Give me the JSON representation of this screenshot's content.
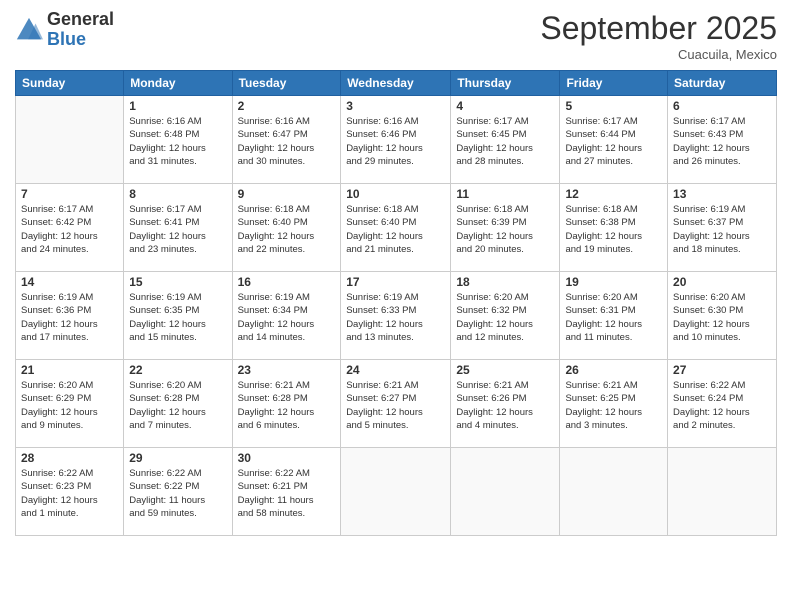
{
  "logo": {
    "general": "General",
    "blue": "Blue"
  },
  "header": {
    "month": "September 2025",
    "location": "Cuacuila, Mexico"
  },
  "weekdays": [
    "Sunday",
    "Monday",
    "Tuesday",
    "Wednesday",
    "Thursday",
    "Friday",
    "Saturday"
  ],
  "weeks": [
    [
      {
        "day": "",
        "info": ""
      },
      {
        "day": "1",
        "info": "Sunrise: 6:16 AM\nSunset: 6:48 PM\nDaylight: 12 hours\nand 31 minutes."
      },
      {
        "day": "2",
        "info": "Sunrise: 6:16 AM\nSunset: 6:47 PM\nDaylight: 12 hours\nand 30 minutes."
      },
      {
        "day": "3",
        "info": "Sunrise: 6:16 AM\nSunset: 6:46 PM\nDaylight: 12 hours\nand 29 minutes."
      },
      {
        "day": "4",
        "info": "Sunrise: 6:17 AM\nSunset: 6:45 PM\nDaylight: 12 hours\nand 28 minutes."
      },
      {
        "day": "5",
        "info": "Sunrise: 6:17 AM\nSunset: 6:44 PM\nDaylight: 12 hours\nand 27 minutes."
      },
      {
        "day": "6",
        "info": "Sunrise: 6:17 AM\nSunset: 6:43 PM\nDaylight: 12 hours\nand 26 minutes."
      }
    ],
    [
      {
        "day": "7",
        "info": "Sunrise: 6:17 AM\nSunset: 6:42 PM\nDaylight: 12 hours\nand 24 minutes."
      },
      {
        "day": "8",
        "info": "Sunrise: 6:17 AM\nSunset: 6:41 PM\nDaylight: 12 hours\nand 23 minutes."
      },
      {
        "day": "9",
        "info": "Sunrise: 6:18 AM\nSunset: 6:40 PM\nDaylight: 12 hours\nand 22 minutes."
      },
      {
        "day": "10",
        "info": "Sunrise: 6:18 AM\nSunset: 6:40 PM\nDaylight: 12 hours\nand 21 minutes."
      },
      {
        "day": "11",
        "info": "Sunrise: 6:18 AM\nSunset: 6:39 PM\nDaylight: 12 hours\nand 20 minutes."
      },
      {
        "day": "12",
        "info": "Sunrise: 6:18 AM\nSunset: 6:38 PM\nDaylight: 12 hours\nand 19 minutes."
      },
      {
        "day": "13",
        "info": "Sunrise: 6:19 AM\nSunset: 6:37 PM\nDaylight: 12 hours\nand 18 minutes."
      }
    ],
    [
      {
        "day": "14",
        "info": "Sunrise: 6:19 AM\nSunset: 6:36 PM\nDaylight: 12 hours\nand 17 minutes."
      },
      {
        "day": "15",
        "info": "Sunrise: 6:19 AM\nSunset: 6:35 PM\nDaylight: 12 hours\nand 15 minutes."
      },
      {
        "day": "16",
        "info": "Sunrise: 6:19 AM\nSunset: 6:34 PM\nDaylight: 12 hours\nand 14 minutes."
      },
      {
        "day": "17",
        "info": "Sunrise: 6:19 AM\nSunset: 6:33 PM\nDaylight: 12 hours\nand 13 minutes."
      },
      {
        "day": "18",
        "info": "Sunrise: 6:20 AM\nSunset: 6:32 PM\nDaylight: 12 hours\nand 12 minutes."
      },
      {
        "day": "19",
        "info": "Sunrise: 6:20 AM\nSunset: 6:31 PM\nDaylight: 12 hours\nand 11 minutes."
      },
      {
        "day": "20",
        "info": "Sunrise: 6:20 AM\nSunset: 6:30 PM\nDaylight: 12 hours\nand 10 minutes."
      }
    ],
    [
      {
        "day": "21",
        "info": "Sunrise: 6:20 AM\nSunset: 6:29 PM\nDaylight: 12 hours\nand 9 minutes."
      },
      {
        "day": "22",
        "info": "Sunrise: 6:20 AM\nSunset: 6:28 PM\nDaylight: 12 hours\nand 7 minutes."
      },
      {
        "day": "23",
        "info": "Sunrise: 6:21 AM\nSunset: 6:28 PM\nDaylight: 12 hours\nand 6 minutes."
      },
      {
        "day": "24",
        "info": "Sunrise: 6:21 AM\nSunset: 6:27 PM\nDaylight: 12 hours\nand 5 minutes."
      },
      {
        "day": "25",
        "info": "Sunrise: 6:21 AM\nSunset: 6:26 PM\nDaylight: 12 hours\nand 4 minutes."
      },
      {
        "day": "26",
        "info": "Sunrise: 6:21 AM\nSunset: 6:25 PM\nDaylight: 12 hours\nand 3 minutes."
      },
      {
        "day": "27",
        "info": "Sunrise: 6:22 AM\nSunset: 6:24 PM\nDaylight: 12 hours\nand 2 minutes."
      }
    ],
    [
      {
        "day": "28",
        "info": "Sunrise: 6:22 AM\nSunset: 6:23 PM\nDaylight: 12 hours\nand 1 minute."
      },
      {
        "day": "29",
        "info": "Sunrise: 6:22 AM\nSunset: 6:22 PM\nDaylight: 11 hours\nand 59 minutes."
      },
      {
        "day": "30",
        "info": "Sunrise: 6:22 AM\nSunset: 6:21 PM\nDaylight: 11 hours\nand 58 minutes."
      },
      {
        "day": "",
        "info": ""
      },
      {
        "day": "",
        "info": ""
      },
      {
        "day": "",
        "info": ""
      },
      {
        "day": "",
        "info": ""
      }
    ]
  ]
}
